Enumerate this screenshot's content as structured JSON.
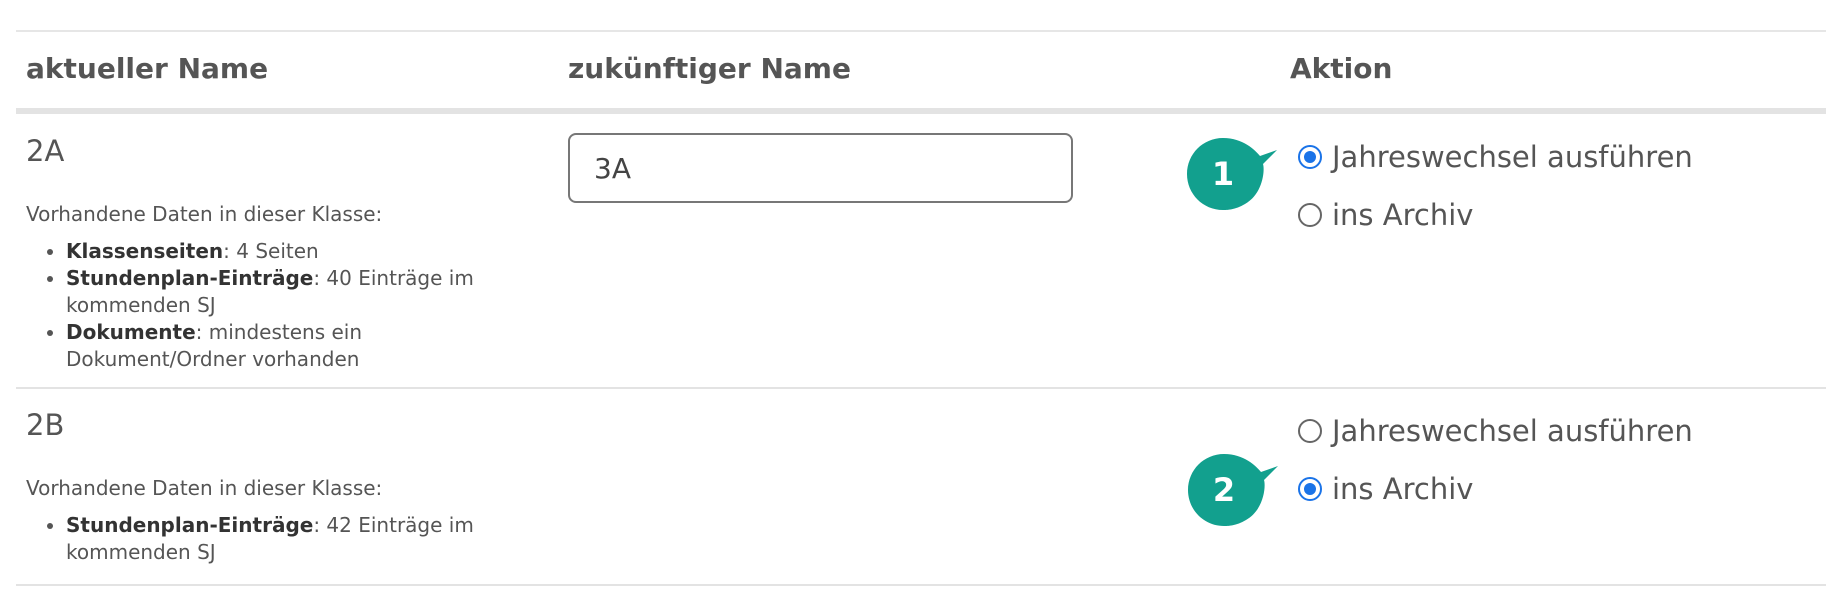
{
  "table": {
    "headers": {
      "current": "aktueller Name",
      "future": "zukünftiger Name",
      "action": "Aktion"
    },
    "rows": [
      {
        "name": "2A",
        "intro": "Vorhandene Daten in dieser Klasse:",
        "items": [
          {
            "label": "Klassenseiten",
            "text": ": 4 Seiten"
          },
          {
            "label": "Stundenplan-Einträge",
            "text": ": 40 Einträge im kommenden SJ"
          },
          {
            "label": "Dokumente",
            "text": ": mindestens ein Dokument/Ordner vorhanden"
          }
        ],
        "future_name": "3A",
        "options": [
          {
            "label": "Jahreswechsel ausführen",
            "checked": true
          },
          {
            "label": "ins Archiv",
            "checked": false
          }
        ],
        "marker": "1"
      },
      {
        "name": "2B",
        "intro": "Vorhandene Daten in dieser Klasse:",
        "items": [
          {
            "label": "Stundenplan-Einträge",
            "text": ": 42 Einträge im kommenden SJ"
          }
        ],
        "options": [
          {
            "label": "Jahreswechsel ausführen",
            "checked": false
          },
          {
            "label": "ins Archiv",
            "checked": true
          }
        ],
        "marker": "2"
      }
    ]
  },
  "colors": {
    "marker": "#12a08e",
    "radio_accent": "#1a73e8"
  }
}
